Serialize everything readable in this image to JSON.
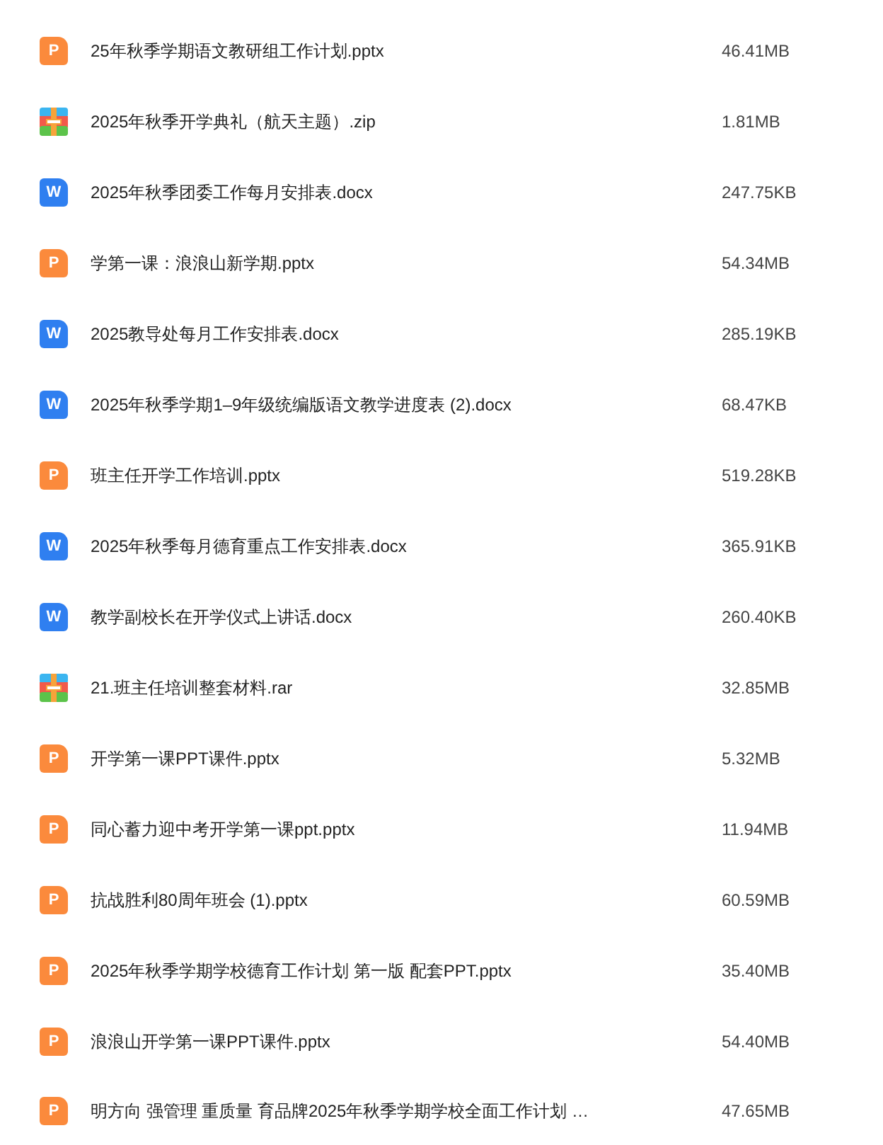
{
  "files": [
    {
      "name": "25年秋季学期语文教研组工作计划.pptx",
      "size": "46.41MB",
      "kind": "slides",
      "badge": "P"
    },
    {
      "name": "2025年秋季开学典礼（航天主题）.zip",
      "size": "1.81MB",
      "kind": "archive"
    },
    {
      "name": "2025年秋季团委工作每月安排表.docx",
      "size": "247.75KB",
      "kind": "document",
      "badge": "W"
    },
    {
      "name": "学第一课：浪浪山新学期.pptx",
      "size": "54.34MB",
      "kind": "slides",
      "badge": "P"
    },
    {
      "name": "2025教导处每月工作安排表.docx",
      "size": "285.19KB",
      "kind": "document",
      "badge": "W"
    },
    {
      "name": "2025年秋季学期1–9年级统编版语文教学进度表 (2).docx",
      "size": "68.47KB",
      "kind": "document",
      "badge": "W"
    },
    {
      "name": "班主任开学工作培训.pptx",
      "size": "519.28KB",
      "kind": "slides",
      "badge": "P"
    },
    {
      "name": "2025年秋季每月德育重点工作安排表.docx",
      "size": "365.91KB",
      "kind": "document",
      "badge": "W"
    },
    {
      "name": "教学副校长在开学仪式上讲话.docx",
      "size": "260.40KB",
      "kind": "document",
      "badge": "W"
    },
    {
      "name": "21.班主任培训整套材料.rar",
      "size": "32.85MB",
      "kind": "archive"
    },
    {
      "name": "开学第一课PPT课件.pptx",
      "size": "5.32MB",
      "kind": "slides",
      "badge": "P"
    },
    {
      "name": "同心蓄力迎中考开学第一课ppt.pptx",
      "size": "11.94MB",
      "kind": "slides",
      "badge": "P"
    },
    {
      "name": "抗战胜利80周年班会 (1).pptx",
      "size": "60.59MB",
      "kind": "slides",
      "badge": "P"
    },
    {
      "name": "2025年秋季学期学校德育工作计划 第一版 配套PPT.pptx",
      "size": "35.40MB",
      "kind": "slides",
      "badge": "P"
    },
    {
      "name": "浪浪山开学第一课PPT课件.pptx",
      "size": "54.40MB",
      "kind": "slides",
      "badge": "P"
    },
    {
      "name": "明方向 强管理 重质量 育品牌2025年秋季学期学校全面工作计划 …",
      "size": "47.65MB",
      "kind": "slides",
      "badge": "P"
    }
  ]
}
